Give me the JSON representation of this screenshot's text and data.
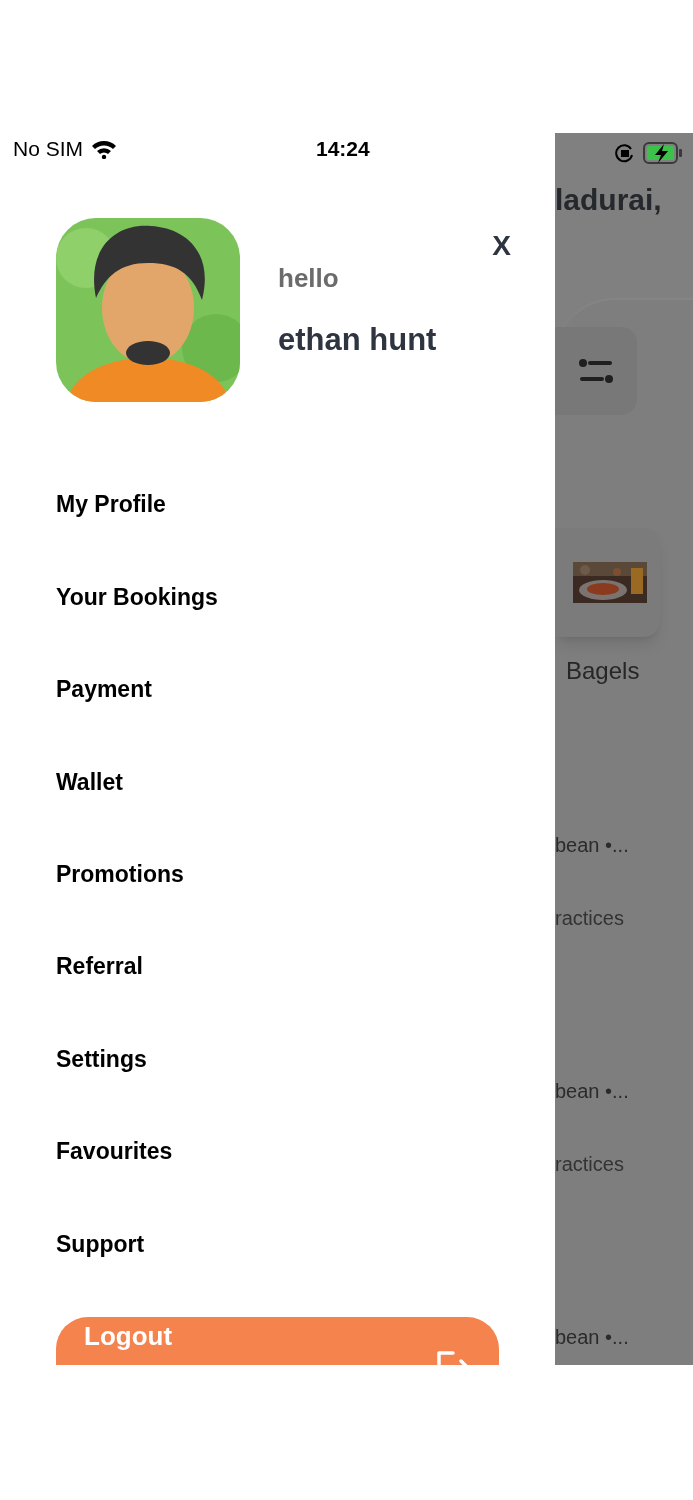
{
  "status_bar": {
    "carrier": "No SIM",
    "time": "14:24"
  },
  "drawer": {
    "greeting": "hello",
    "name": "ethan hunt",
    "close": "X",
    "menu": [
      {
        "label": "My Profile"
      },
      {
        "label": "Your Bookings"
      },
      {
        "label": "Payment"
      },
      {
        "label": "Wallet"
      },
      {
        "label": "Promotions"
      },
      {
        "label": "Referral"
      },
      {
        "label": "Settings"
      },
      {
        "label": "Favourites"
      },
      {
        "label": "Support"
      }
    ],
    "logout": "Logout"
  },
  "background": {
    "location": "ladurai,",
    "category": "Bagels",
    "restaurants": [
      {
        "cuisine": "bean •...",
        "note": "ractices"
      },
      {
        "cuisine": "bean •...",
        "note": "ractices"
      },
      {
        "cuisine": "bean •..."
      }
    ]
  }
}
